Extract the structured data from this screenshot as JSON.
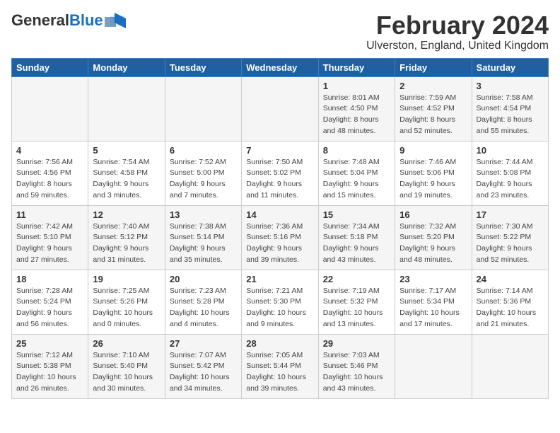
{
  "header": {
    "logo_general": "General",
    "logo_blue": "Blue",
    "month_title": "February 2024",
    "location": "Ulverston, England, United Kingdom"
  },
  "days_of_week": [
    "Sunday",
    "Monday",
    "Tuesday",
    "Wednesday",
    "Thursday",
    "Friday",
    "Saturday"
  ],
  "weeks": [
    [
      {
        "day": "",
        "info": ""
      },
      {
        "day": "",
        "info": ""
      },
      {
        "day": "",
        "info": ""
      },
      {
        "day": "",
        "info": ""
      },
      {
        "day": "1",
        "info": "Sunrise: 8:01 AM\nSunset: 4:50 PM\nDaylight: 8 hours\nand 48 minutes."
      },
      {
        "day": "2",
        "info": "Sunrise: 7:59 AM\nSunset: 4:52 PM\nDaylight: 8 hours\nand 52 minutes."
      },
      {
        "day": "3",
        "info": "Sunrise: 7:58 AM\nSunset: 4:54 PM\nDaylight: 8 hours\nand 55 minutes."
      }
    ],
    [
      {
        "day": "4",
        "info": "Sunrise: 7:56 AM\nSunset: 4:56 PM\nDaylight: 8 hours\nand 59 minutes."
      },
      {
        "day": "5",
        "info": "Sunrise: 7:54 AM\nSunset: 4:58 PM\nDaylight: 9 hours\nand 3 minutes."
      },
      {
        "day": "6",
        "info": "Sunrise: 7:52 AM\nSunset: 5:00 PM\nDaylight: 9 hours\nand 7 minutes."
      },
      {
        "day": "7",
        "info": "Sunrise: 7:50 AM\nSunset: 5:02 PM\nDaylight: 9 hours\nand 11 minutes."
      },
      {
        "day": "8",
        "info": "Sunrise: 7:48 AM\nSunset: 5:04 PM\nDaylight: 9 hours\nand 15 minutes."
      },
      {
        "day": "9",
        "info": "Sunrise: 7:46 AM\nSunset: 5:06 PM\nDaylight: 9 hours\nand 19 minutes."
      },
      {
        "day": "10",
        "info": "Sunrise: 7:44 AM\nSunset: 5:08 PM\nDaylight: 9 hours\nand 23 minutes."
      }
    ],
    [
      {
        "day": "11",
        "info": "Sunrise: 7:42 AM\nSunset: 5:10 PM\nDaylight: 9 hours\nand 27 minutes."
      },
      {
        "day": "12",
        "info": "Sunrise: 7:40 AM\nSunset: 5:12 PM\nDaylight: 9 hours\nand 31 minutes."
      },
      {
        "day": "13",
        "info": "Sunrise: 7:38 AM\nSunset: 5:14 PM\nDaylight: 9 hours\nand 35 minutes."
      },
      {
        "day": "14",
        "info": "Sunrise: 7:36 AM\nSunset: 5:16 PM\nDaylight: 9 hours\nand 39 minutes."
      },
      {
        "day": "15",
        "info": "Sunrise: 7:34 AM\nSunset: 5:18 PM\nDaylight: 9 hours\nand 43 minutes."
      },
      {
        "day": "16",
        "info": "Sunrise: 7:32 AM\nSunset: 5:20 PM\nDaylight: 9 hours\nand 48 minutes."
      },
      {
        "day": "17",
        "info": "Sunrise: 7:30 AM\nSunset: 5:22 PM\nDaylight: 9 hours\nand 52 minutes."
      }
    ],
    [
      {
        "day": "18",
        "info": "Sunrise: 7:28 AM\nSunset: 5:24 PM\nDaylight: 9 hours\nand 56 minutes."
      },
      {
        "day": "19",
        "info": "Sunrise: 7:25 AM\nSunset: 5:26 PM\nDaylight: 10 hours\nand 0 minutes."
      },
      {
        "day": "20",
        "info": "Sunrise: 7:23 AM\nSunset: 5:28 PM\nDaylight: 10 hours\nand 4 minutes."
      },
      {
        "day": "21",
        "info": "Sunrise: 7:21 AM\nSunset: 5:30 PM\nDaylight: 10 hours\nand 9 minutes."
      },
      {
        "day": "22",
        "info": "Sunrise: 7:19 AM\nSunset: 5:32 PM\nDaylight: 10 hours\nand 13 minutes."
      },
      {
        "day": "23",
        "info": "Sunrise: 7:17 AM\nSunset: 5:34 PM\nDaylight: 10 hours\nand 17 minutes."
      },
      {
        "day": "24",
        "info": "Sunrise: 7:14 AM\nSunset: 5:36 PM\nDaylight: 10 hours\nand 21 minutes."
      }
    ],
    [
      {
        "day": "25",
        "info": "Sunrise: 7:12 AM\nSunset: 5:38 PM\nDaylight: 10 hours\nand 26 minutes."
      },
      {
        "day": "26",
        "info": "Sunrise: 7:10 AM\nSunset: 5:40 PM\nDaylight: 10 hours\nand 30 minutes."
      },
      {
        "day": "27",
        "info": "Sunrise: 7:07 AM\nSunset: 5:42 PM\nDaylight: 10 hours\nand 34 minutes."
      },
      {
        "day": "28",
        "info": "Sunrise: 7:05 AM\nSunset: 5:44 PM\nDaylight: 10 hours\nand 39 minutes."
      },
      {
        "day": "29",
        "info": "Sunrise: 7:03 AM\nSunset: 5:46 PM\nDaylight: 10 hours\nand 43 minutes."
      },
      {
        "day": "",
        "info": ""
      },
      {
        "day": "",
        "info": ""
      }
    ]
  ]
}
